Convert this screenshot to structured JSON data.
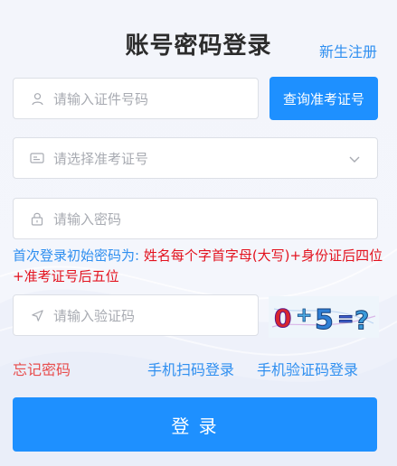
{
  "title": "账号密码登录",
  "register_link": "新生注册",
  "id_field": {
    "placeholder": "请输入证件号码",
    "icon": "user-icon"
  },
  "query_button": "查询准考证号",
  "exam_select": {
    "placeholder": "请选择准考证号",
    "icon": "id-card-icon"
  },
  "password_field": {
    "placeholder": "请输入密码",
    "icon": "lock-icon"
  },
  "hint": {
    "prefix": "首次登录初始密码为: ",
    "rule": "姓名每个字首字母(大写)+身份证后四位+准考证号后五位"
  },
  "captcha_field": {
    "placeholder": "请输入验证码",
    "icon": "send-icon"
  },
  "captcha_image": {
    "text": "0+5=?"
  },
  "forgot_password": "忘记密码",
  "scan_login": "手机扫码登录",
  "sms_login": "手机验证码登录",
  "login_button": "登 录",
  "colors": {
    "accent": "#1e90ff",
    "link": "#2f8ff0",
    "warning_red": "#e3121e",
    "forgot_red": "#e84d4d"
  }
}
